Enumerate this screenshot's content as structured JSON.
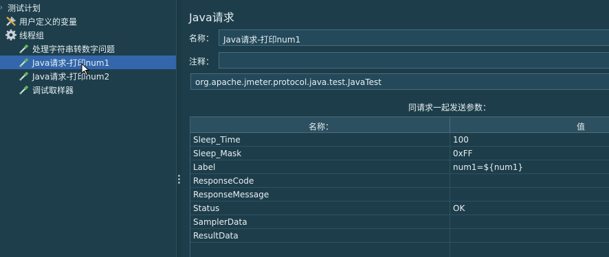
{
  "tree": {
    "items": [
      {
        "label": "测试计划",
        "icon": "test-plan-icon"
      },
      {
        "label": "用户定义的变量",
        "icon": "wrench-icon"
      },
      {
        "label": "线程组",
        "icon": "gear-icon"
      },
      {
        "label": "处理字符串转数字问题",
        "icon": "pipette-icon"
      },
      {
        "label": "Java请求-打印num1",
        "icon": "pipette-icon",
        "selected": true
      },
      {
        "label": "Java请求-打印num2",
        "icon": "pipette-icon"
      },
      {
        "label": "调试取样器",
        "icon": "pipette-icon"
      }
    ]
  },
  "main": {
    "title": "Java请求",
    "name_label": "名称：",
    "name_value": "Java请求-打印num1",
    "comment_label": "注释：",
    "comment_value": "",
    "classname": "org.apache.jmeter.protocol.java.test.JavaTest",
    "params_caption": "同请求一起发送参数：",
    "table": {
      "headers": [
        "名称：",
        "值"
      ],
      "rows": [
        {
          "name": "Sleep_Time",
          "value": "100"
        },
        {
          "name": "Sleep_Mask",
          "value": "0xFF"
        },
        {
          "name": "Label",
          "value": "num1=${num1}"
        },
        {
          "name": "ResponseCode",
          "value": ""
        },
        {
          "name": "ResponseMessage",
          "value": ""
        },
        {
          "name": "Status",
          "value": "OK"
        },
        {
          "name": "SamplerData",
          "value": ""
        },
        {
          "name": "ResultData",
          "value": ""
        }
      ]
    }
  },
  "colors": {
    "background": "#1d3d4a",
    "selection": "#3366aa",
    "table_header": "#2d5060"
  }
}
